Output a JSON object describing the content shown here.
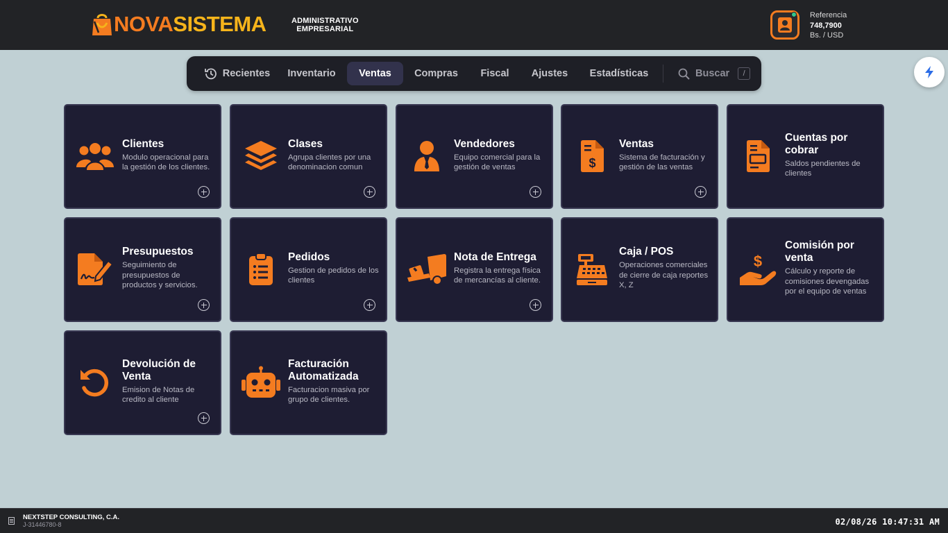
{
  "header": {
    "logo": {
      "part1": "NOVA",
      "part2": "SISTEMA",
      "subtitle_line1": "ADMINISTRATIVO",
      "subtitle_line2": "EMPRESARIAL"
    },
    "rate": {
      "label": "Referencia",
      "value": "748,7900",
      "unit": "Bs. / USD"
    },
    "user_icon": "user-avatar-icon",
    "status_color": "#34c78a"
  },
  "tabs": [
    {
      "label": "Recientes",
      "icon": "history-icon",
      "active": false
    },
    {
      "label": "Inventario",
      "active": false
    },
    {
      "label": "Ventas",
      "active": true
    },
    {
      "label": "Compras",
      "active": false
    },
    {
      "label": "Fiscal",
      "active": false
    },
    {
      "label": "Ajustes",
      "active": false
    },
    {
      "label": "Estadísticas",
      "active": false
    }
  ],
  "search": {
    "label": "Buscar",
    "shortcut": "/",
    "icon": "search-icon"
  },
  "quick_action_icon": "lightning-icon",
  "colors": {
    "accent": "#f47c20",
    "card_bg": "#1e1d33",
    "page_bg": "#c0d0d4",
    "header_bg": "#222326",
    "quick_icon": "#2b6ce6"
  },
  "cards": [
    {
      "title": "Clientes",
      "desc": "Modulo operacional para la gestión de los clientes.",
      "icon": "users-icon",
      "add": true
    },
    {
      "title": "Clases",
      "desc": "Agrupa clientes por una denominacion comun",
      "icon": "layers-icon",
      "add": true
    },
    {
      "title": "Vendedores",
      "desc": "Equipo comercial para la gestión de ventas",
      "icon": "salesperson-icon",
      "add": true
    },
    {
      "title": "Ventas",
      "desc": "Sistema de facturación y gestión de las ventas",
      "icon": "invoice-dollar-icon",
      "add": true
    },
    {
      "title": "Cuentas por cobrar",
      "desc": "Saldos pendientes de clientes",
      "icon": "receivable-document-icon",
      "add": false
    },
    {
      "title": "Presupuestos",
      "desc": "Seguimiento de presupuestos de productos y servicios.",
      "icon": "file-signature-icon",
      "add": true
    },
    {
      "title": "Pedidos",
      "desc": "Gestion de pedidos de los clientes",
      "icon": "clipboard-list-icon",
      "add": true
    },
    {
      "title": "Nota de Entrega",
      "desc": "Registra la entrega física de mercancías al cliente.",
      "icon": "dolly-icon",
      "add": true
    },
    {
      "title": "Caja / POS",
      "desc": "Operaciones comerciales de cierre de caja reportes X, Z",
      "icon": "cash-register-icon",
      "add": false
    },
    {
      "title": "Comisión por venta",
      "desc": "Cálculo y reporte de comisiones devengadas por el equipo de ventas",
      "icon": "hand-dollar-icon",
      "add": false
    },
    {
      "title": "Devolución de Venta",
      "desc": "Emision de Notas de credito al cliente",
      "icon": "rotate-left-icon",
      "add": true
    },
    {
      "title": "Facturación Automatizada",
      "desc": "Facturacion masiva por grupo de clientes.",
      "icon": "robot-icon",
      "add": false
    }
  ],
  "footer": {
    "company": "NEXTSTEP CONSULTING, C.A.",
    "rif": "J-31446780-8",
    "datetime": "02/08/26 10:47:31 AM",
    "icon": "building-icon"
  }
}
